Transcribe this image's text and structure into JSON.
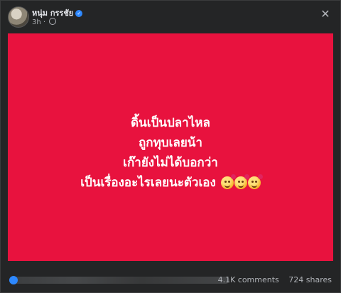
{
  "post": {
    "author_name": "หนุ่ม กรรชัย",
    "time": "3h",
    "privacy_dot": "·",
    "text_lines": [
      "ดิ้นเป็นปลาไหล",
      "ถูกทุบเลยน้า",
      "เก๊ายังไม่ได้บอกว่า",
      "เป็นเรื่องอะไรเลยนะตัวเอง"
    ],
    "background_color": "#e8123e",
    "emoji": [
      "smiling-face-with-hearts",
      "smiling-face-with-hearts",
      "smiling-face-with-hearts"
    ]
  },
  "footer": {
    "comments": "4.1K comments",
    "shares": "724 shares"
  },
  "icons": {
    "verified": "verified-badge-icon",
    "globe": "globe-icon",
    "close": "close-icon"
  }
}
